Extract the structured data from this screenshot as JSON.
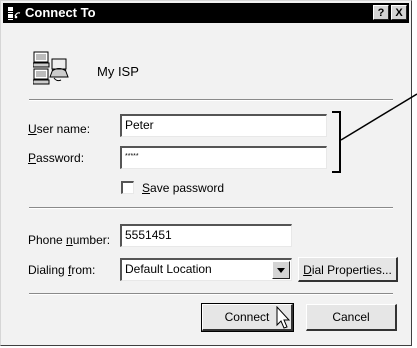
{
  "window": {
    "title": "Connect To",
    "help_label": "?",
    "close_label": "X"
  },
  "connection": {
    "name": "My ISP",
    "icon": "network-computers-icon"
  },
  "form": {
    "username_label_u": "U",
    "username_label_rest": "ser name:",
    "username_value": "Peter",
    "password_label_u": "P",
    "password_label_rest": "assword:",
    "password_value": "*****",
    "save_password_u": "S",
    "save_password_rest": "ave password",
    "save_password_checked": false,
    "phone_label_pre": "Phone ",
    "phone_label_u": "n",
    "phone_label_rest": "umber:",
    "phone_value": "5551451",
    "dialing_label_pre": "Dialing ",
    "dialing_label_u": "f",
    "dialing_label_rest": "rom:",
    "dialing_value": "Default Location",
    "dial_props_u": "D",
    "dial_props_rest": "ial Properties..."
  },
  "buttons": {
    "connect": "Connect",
    "cancel": "Cancel"
  }
}
